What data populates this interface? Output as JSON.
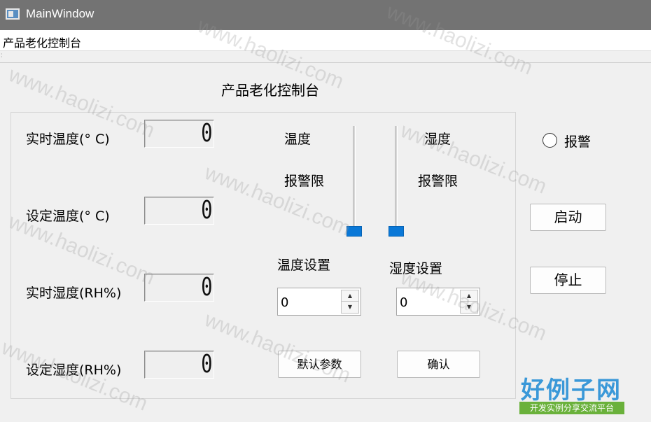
{
  "window": {
    "title": "MainWindow"
  },
  "menu": {
    "item": "产品老化控制台"
  },
  "header": {
    "title": "产品老化控制台"
  },
  "readouts": [
    {
      "label": "实时温度(° C)",
      "value": "0"
    },
    {
      "label": "设定温度(° C)",
      "value": "0"
    },
    {
      "label": "实时湿度(RH%)",
      "value": "0"
    },
    {
      "label": "设定湿度(RH%)",
      "value": "0"
    }
  ],
  "sliders": {
    "temp_label_line1": "温度",
    "temp_label_line2": "报警限",
    "humid_label_line1": "湿度",
    "humid_label_line2": "报警限"
  },
  "settings": {
    "temp_label": "温度设置",
    "temp_value": "0",
    "humid_label": "湿度设置",
    "humid_value": "0",
    "default_button": "默认参数",
    "confirm_button": "确认"
  },
  "controls": {
    "alarm_label": "报警",
    "start_button": "启动",
    "stop_button": "停止"
  },
  "watermark": {
    "text": "www.haolizi.com"
  },
  "logo": {
    "main": "好例子网",
    "sub": "开发实例分享交流平台"
  }
}
